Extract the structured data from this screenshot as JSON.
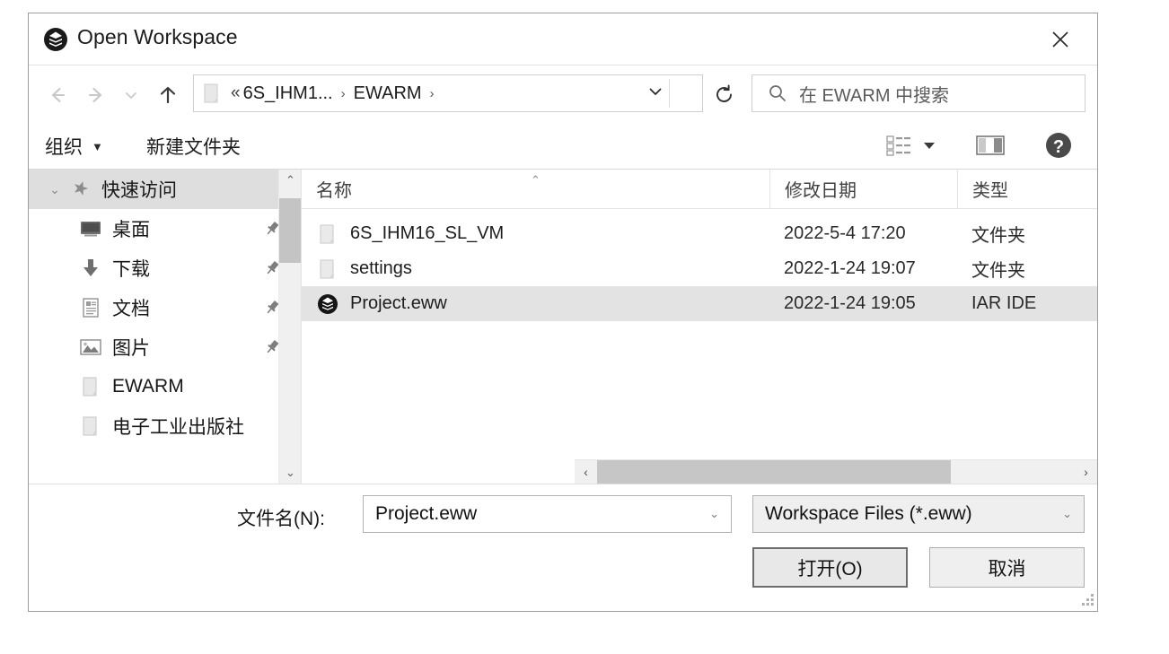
{
  "dialog": {
    "title": "Open Workspace",
    "title_icon": "iar-workspace-icon",
    "close_label": "✕"
  },
  "nav": {
    "back_icon": "←",
    "forward_icon": "→",
    "recent_icon": "⌄",
    "up_icon": "↑",
    "breadcrumb": {
      "overflow": "«",
      "segments": [
        "6S_IHM1...",
        "EWARM"
      ],
      "separator": "›",
      "dropdown_icon": "⌄"
    },
    "refresh_icon": "↺",
    "search": {
      "placeholder": "在 EWARM 中搜索",
      "icon": "search-icon"
    }
  },
  "toolbar": {
    "organize_label": "组织",
    "organize_caret": "▼",
    "new_folder_label": "新建文件夹",
    "view_icon": "list-view-icon",
    "view_caret": "▼",
    "preview_pane_icon": "preview-pane-icon",
    "help_icon": "?"
  },
  "sidebar": {
    "expander_icon": "⌄",
    "items": [
      {
        "label": "快速访问",
        "icon": "star-pin-icon",
        "group": true,
        "pinned": false,
        "indent": false
      },
      {
        "label": "桌面",
        "icon": "desktop-icon",
        "group": false,
        "pinned": true,
        "indent": true
      },
      {
        "label": "下载",
        "icon": "download-icon",
        "group": false,
        "pinned": true,
        "indent": true
      },
      {
        "label": "文档",
        "icon": "documents-icon",
        "group": false,
        "pinned": true,
        "indent": true
      },
      {
        "label": "图片",
        "icon": "pictures-icon",
        "group": false,
        "pinned": true,
        "indent": true
      },
      {
        "label": "EWARM",
        "icon": "folder-icon",
        "group": false,
        "pinned": false,
        "indent": true
      },
      {
        "label": "电子工业出版社",
        "icon": "folder-icon",
        "group": false,
        "pinned": false,
        "indent": true
      }
    ],
    "scroll_up_icon": "⌃",
    "scroll_down_icon": "⌄"
  },
  "filelist": {
    "columns": [
      {
        "key": "name",
        "label": "名称",
        "sorted": true,
        "sort_icon": "⌃"
      },
      {
        "key": "date",
        "label": "修改日期",
        "sorted": false,
        "sort_icon": ""
      },
      {
        "key": "type",
        "label": "类型",
        "sorted": false,
        "sort_icon": ""
      }
    ],
    "rows": [
      {
        "name": "6S_IHM16_SL_VM",
        "date": "2022-5-4 17:20",
        "type": "文件夹",
        "icon": "folder-icon",
        "selected": false
      },
      {
        "name": "settings",
        "date": "2022-1-24 19:07",
        "type": "文件夹",
        "icon": "folder-icon",
        "selected": false
      },
      {
        "name": "Project.eww",
        "date": "2022-1-24 19:05",
        "type": "IAR IDE",
        "icon": "iar-workspace-icon",
        "selected": true
      }
    ],
    "hscroll": {
      "left_icon": "‹",
      "right_icon": "›",
      "thumb_fraction": 0.74
    }
  },
  "footer": {
    "filename_label": "文件名(N):",
    "filename_value": "Project.eww",
    "filename_chevron": "⌄",
    "filter_value": "Workspace Files (*.eww)",
    "filter_chevron": "⌄",
    "open_label": "打开(O)",
    "cancel_label": "取消"
  },
  "colors": {
    "selection": "#e3e3e3",
    "group_header": "#dedede",
    "scrollbar_thumb": "#c4c4c4",
    "border": "#9c9c9c"
  }
}
